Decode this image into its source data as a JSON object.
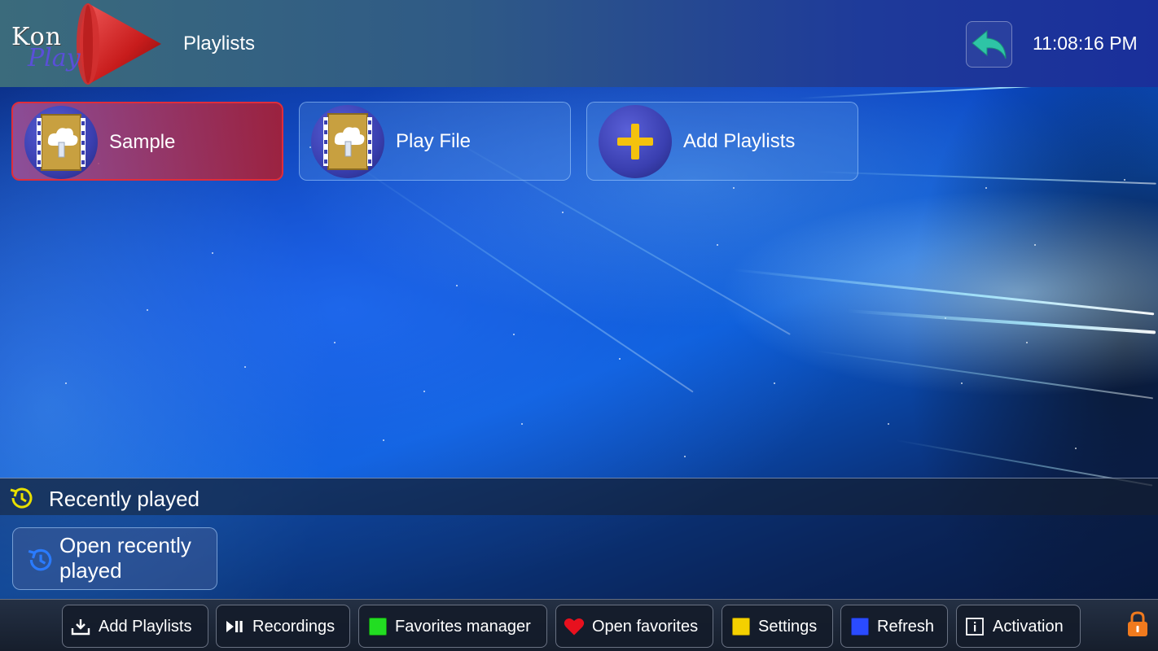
{
  "header": {
    "logo_text_top": "Kon",
    "logo_text_bottom": "Play",
    "title": "Playlists",
    "back_icon": "back-arrow-icon",
    "clock": "11:08:16 PM"
  },
  "playlists": [
    {
      "label": "Sample",
      "icon": "playlist-file-icon",
      "selected": true
    },
    {
      "label": "Play File",
      "icon": "playlist-file-icon",
      "selected": false
    },
    {
      "label": "Add Playlists",
      "icon": "plus-icon",
      "selected": false
    }
  ],
  "recent": {
    "title": "Recently played",
    "open_button": "Open recently played"
  },
  "toolbar": {
    "add_playlists": "Add Playlists",
    "recordings": "Recordings",
    "favorites_manager": "Favorites manager",
    "open_favorites": "Open favorites",
    "settings": "Settings",
    "refresh": "Refresh",
    "activation": "Activation"
  },
  "colors": {
    "selected_tile": "#a8263a",
    "favorites_green": "#22dd22",
    "favorites_heart": "#e8101e",
    "settings_yellow": "#f4d000",
    "refresh_blue": "#2a4bff",
    "plus_yellow": "#f4c20d",
    "back_arrow": "#2ec4a6",
    "lock_orange": "#f07a1e"
  }
}
